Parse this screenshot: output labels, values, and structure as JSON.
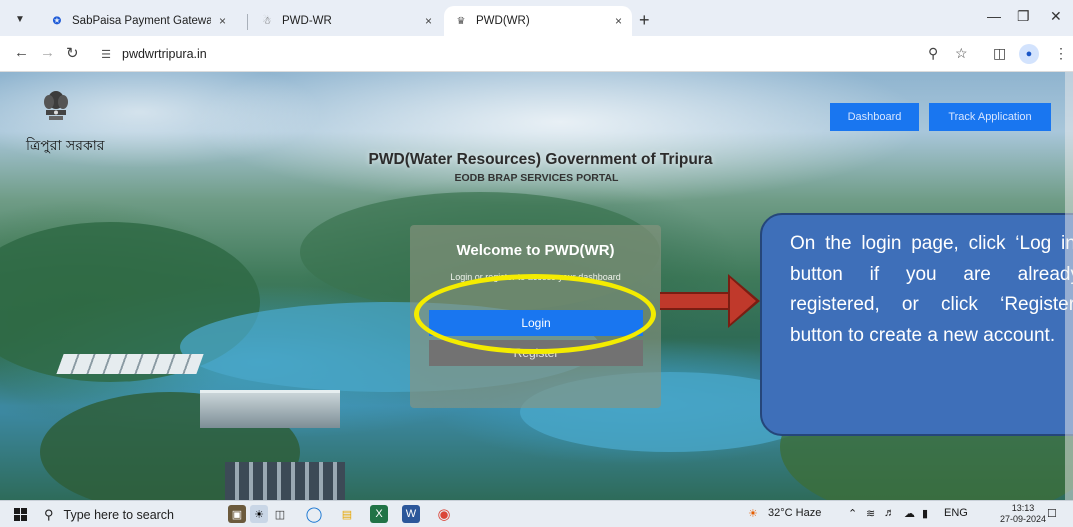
{
  "browser": {
    "tabs": [
      {
        "title": "SabPaisa Payment Gateway",
        "active": false
      },
      {
        "title": "PWD-WR",
        "active": false
      },
      {
        "title": "PWD(WR)",
        "active": true
      }
    ],
    "close_glyph": "×",
    "new_tab_glyph": "+",
    "url": "pwdwrtripura.in",
    "accent_color": "#1976f0"
  },
  "header": {
    "emblem_caption": "ত্রিপুরা সরকার",
    "dashboard_label": "Dashboard",
    "track_label": "Track Application"
  },
  "portal": {
    "title": "PWD(Water Resources) Government of Tripura",
    "subtitle": "EODB BRAP SERVICES PORTAL"
  },
  "card": {
    "title": "Welcome to PWD(WR)",
    "subtitle": "Login or register to access your dashboard",
    "login_label": "Login",
    "register_label": "Register"
  },
  "annotation": {
    "text": "On the login page, click ‘Log in’ button if you are already registered, or click ‘Register’ button to create a new account.",
    "highlight_color": "#f4ec00",
    "callout_color": "#3e6fb9",
    "arrow_color": "#c0392b"
  },
  "taskbar": {
    "search_placeholder": "Type here to search",
    "weather": "32°C  Haze",
    "language": "ENG",
    "time": "13:13",
    "date": "27-09-2024"
  }
}
